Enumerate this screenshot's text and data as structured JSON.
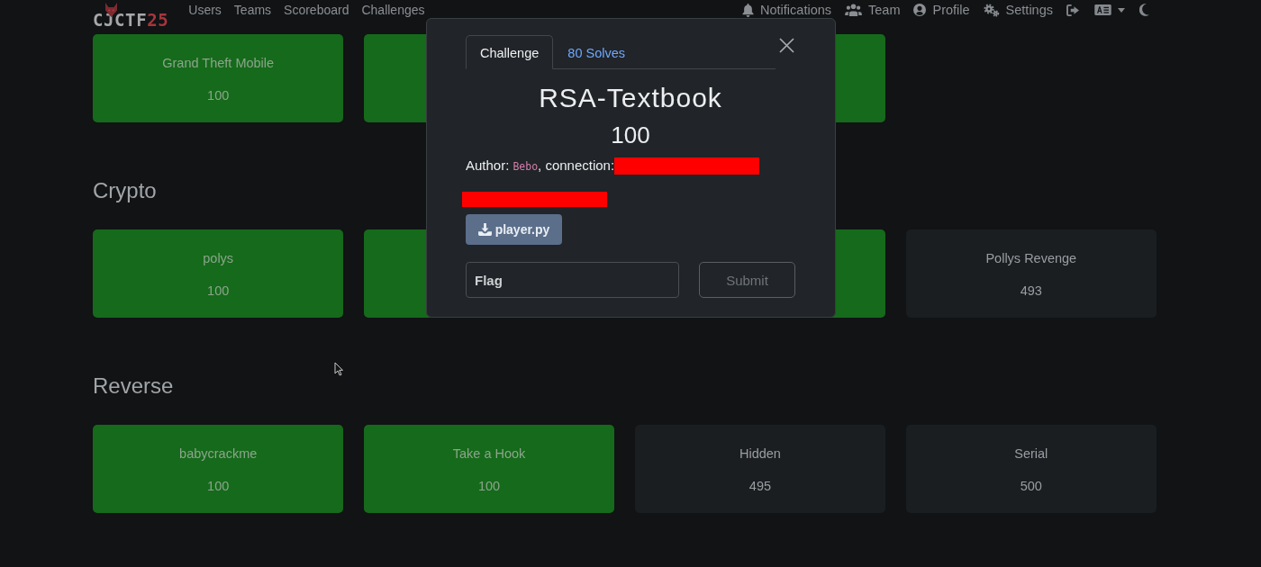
{
  "navbar": {
    "logo": {
      "text": "CJCTF",
      "suffix": "25"
    },
    "links": [
      {
        "label": "Users"
      },
      {
        "label": "Teams"
      },
      {
        "label": "Scoreboard"
      },
      {
        "label": "Challenges"
      }
    ],
    "right_items": [
      {
        "kind": "notifications",
        "label": "Notifications"
      },
      {
        "kind": "team",
        "label": "Team"
      },
      {
        "kind": "profile",
        "label": "Profile"
      },
      {
        "kind": "settings",
        "label": "Settings"
      },
      {
        "kind": "logout"
      },
      {
        "kind": "language"
      },
      {
        "kind": "theme"
      }
    ]
  },
  "sections": [
    {
      "cards": [
        {
          "name": "Grand Theft Mobile",
          "value": "100",
          "solved": true
        },
        {
          "solved": true
        },
        {
          "solved": true
        }
      ]
    },
    {
      "title": "Crypto",
      "cards": [
        {
          "name": "polys",
          "value": "100",
          "solved": true
        },
        {
          "solved": true
        },
        {
          "solved": true
        },
        {
          "name": "Pollys Revenge",
          "value": "493",
          "solved": false
        }
      ]
    },
    {
      "title": "Reverse",
      "cards": [
        {
          "name": "babycrackme",
          "value": "100",
          "solved": true
        },
        {
          "name": "Take a Hook",
          "value": "100",
          "solved": true
        },
        {
          "name": "Hidden",
          "value": "495",
          "solved": false
        },
        {
          "name": "Serial",
          "value": "500",
          "solved": false
        }
      ]
    }
  ],
  "modal": {
    "tabs": [
      {
        "label": "Challenge",
        "selected": true
      },
      {
        "label": "80 Solves",
        "selected": false
      }
    ],
    "title": "RSA-Textbook",
    "value": "100",
    "author_line": {
      "prefix": "Author:",
      "author": "Bebo",
      "suffix": ", connection:"
    },
    "files": [
      {
        "name": "player.py"
      }
    ],
    "flag_field": {
      "placeholder": "Flag"
    },
    "submit_button": "Submit"
  }
}
